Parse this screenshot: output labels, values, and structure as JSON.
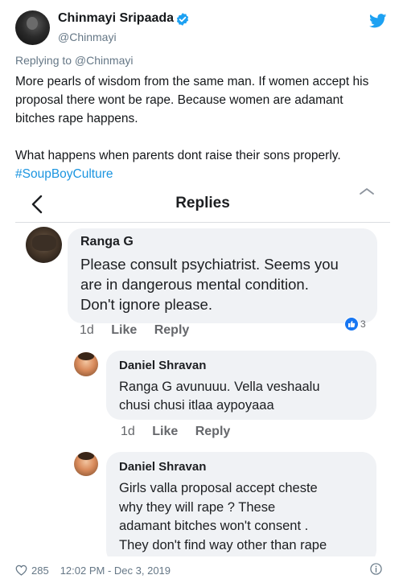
{
  "header": {
    "display_name": "Chinmayi Sripaada",
    "handle": "@Chinmayi",
    "verified_icon": "verified-badge-icon",
    "logo_icon": "twitter-bird-icon"
  },
  "tweet": {
    "replying_to": "Replying to @Chinmayi",
    "text_lines": [
      "More pearls of wisdom from the same man. If women accept his",
      "proposal there wont be rape. Because women are adamant",
      "bitches rape happens.",
      "What happens when parents dont raise their sons properly."
    ],
    "hashtag": "#SoupBoyCulture"
  },
  "embedded": {
    "title": "Replies",
    "comments": [
      {
        "author": "Ranga G",
        "lines": [
          "Please consult psychiatrist. Seems you",
          "are in dangerous mental condition.",
          "Don't ignore please."
        ],
        "time": "1d",
        "like_label": "Like",
        "reply_label": "Reply",
        "reactions": "3"
      },
      {
        "author": "Daniel Shravan",
        "lines": [
          "Ranga G avunuuu. Vella veshaalu",
          "chusi chusi itlaa aypoyaaa"
        ],
        "time": "1d",
        "like_label": "Like",
        "reply_label": "Reply"
      },
      {
        "author": "Daniel Shravan",
        "lines": [
          "Girls valla proposal accept cheste",
          "why they will rape ? These",
          "adamant bitches won't consent .",
          "They don't find way other than rape"
        ]
      }
    ]
  },
  "footer": {
    "likes": "285",
    "timestamp": "12:02 PM - Dec 3, 2019"
  },
  "colors": {
    "link": "#1b95e0",
    "verified": "#1da1f2",
    "bubble": "#f0f2f5",
    "fb_blue": "#1877f2"
  }
}
